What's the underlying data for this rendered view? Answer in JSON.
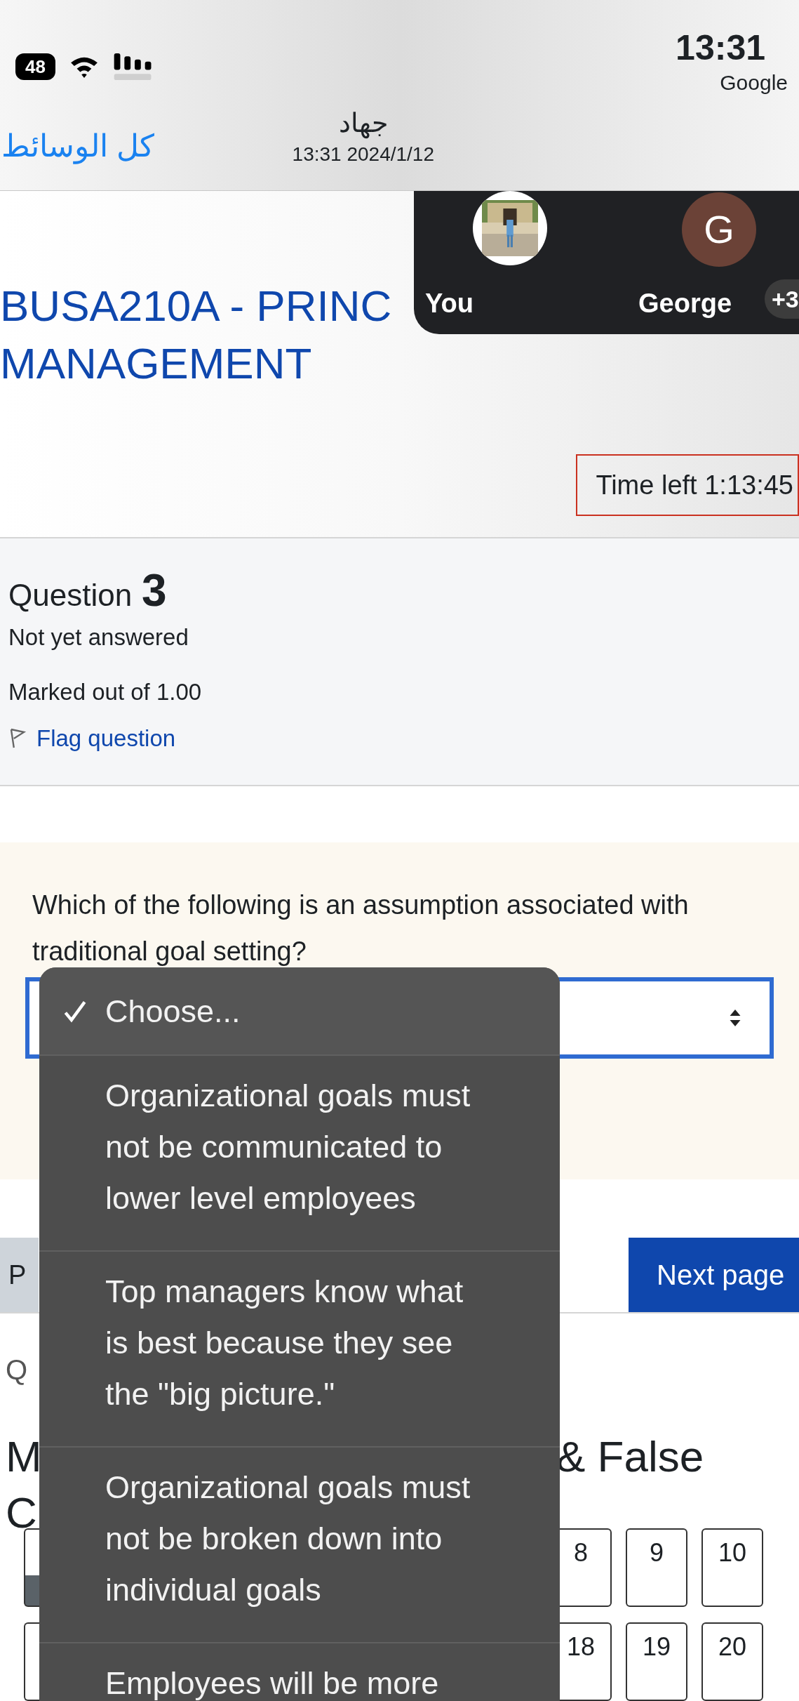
{
  "status_bar": {
    "battery": "48",
    "time": "13:31",
    "carrier": "Google"
  },
  "header": {
    "back_link": "كل الوسائط",
    "sender": "جهاد",
    "date": "13:31 2024/1/12"
  },
  "meet_overlay": {
    "participants": [
      {
        "name": "You"
      },
      {
        "name": "George",
        "kind": "initial",
        "initial": "G"
      }
    ],
    "more": "+3"
  },
  "course_title_lines": [
    "BUSA210A - PRINC",
    "MANAGEMENT"
  ],
  "timer": "Time left 1:13:45",
  "question": {
    "label": "Question",
    "number": "3",
    "status": "Not yet answered",
    "marks": "Marked out of 1.00",
    "flag": "Flag question",
    "text": "Which of the following is an assumption associated with traditional goal setting?"
  },
  "dropdown": {
    "options": [
      {
        "label": "Choose...",
        "selected": true
      },
      {
        "label": "Organizational goals must not be communicated to lower level employees",
        "selected": false
      },
      {
        "label": "Top managers know what is best because they see the \"big picture.\"",
        "selected": false
      },
      {
        "label": "Organizational goals must not be broken down into individual goals",
        "selected": false
      },
      {
        "label": "Employees will be more",
        "selected": false
      }
    ]
  },
  "page_nav": {
    "previous": "P",
    "next": "Next page"
  },
  "quiz_nav": {
    "heading": "Q",
    "title_start": [
      "M",
      "C"
    ],
    "title_end": "& False",
    "rows": [
      [
        "8",
        "9",
        "10"
      ],
      [
        "18",
        "19",
        "20"
      ]
    ]
  }
}
